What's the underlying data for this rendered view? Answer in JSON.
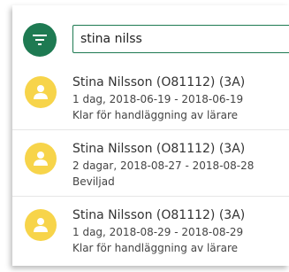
{
  "search": {
    "value": "stina nilss",
    "filter_icon": "filter-icon"
  },
  "results": [
    {
      "name": "Stina Nilsson (O81112) (3A)",
      "period": "1 dag, 2018-06-19 - 2018-06-19",
      "status": "Klar för handläggning av lärare",
      "avatar_icon": "person-icon"
    },
    {
      "name": "Stina Nilsson (O81112) (3A)",
      "period": "2 dagar, 2018-08-27 - 2018-08-28",
      "status": "Beviljad",
      "avatar_icon": "person-icon"
    },
    {
      "name": "Stina Nilsson (O81112) (3A)",
      "period": "1 dag, 2018-08-29 - 2018-08-29",
      "status": "Klar för handläggning av lärare",
      "avatar_icon": "person-icon"
    }
  ],
  "colors": {
    "accent": "#1e7a52",
    "avatar": "#f7d44a"
  }
}
